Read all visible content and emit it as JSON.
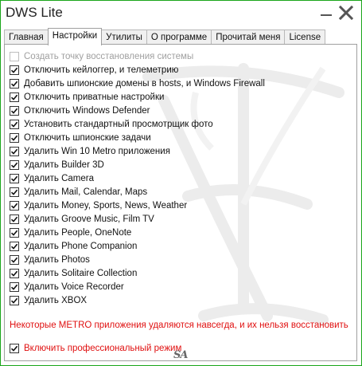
{
  "window": {
    "title": "DWS Lite"
  },
  "tabs": [
    {
      "label": "Главная",
      "active": false
    },
    {
      "label": "Настройки",
      "active": true
    },
    {
      "label": "Утилиты",
      "active": false
    },
    {
      "label": "О программе",
      "active": false
    },
    {
      "label": "Прочитай меня",
      "active": false
    },
    {
      "label": "License",
      "active": false
    }
  ],
  "options": [
    {
      "label": "Создать точку восстановления системы",
      "checked": false,
      "disabled": true
    },
    {
      "label": "Отключить кейлоггер, и телеметрию",
      "checked": true,
      "disabled": false
    },
    {
      "label": "Добавить шпионские домены в hosts, и Windows Firewall",
      "checked": true,
      "disabled": false
    },
    {
      "label": "Отключить приватные настройки",
      "checked": true,
      "disabled": false
    },
    {
      "label": "Отключить Windows Defender",
      "checked": true,
      "disabled": false
    },
    {
      "label": "Установить стандартный просмотрщик фото",
      "checked": true,
      "disabled": false
    },
    {
      "label": "Отключить шпионские задачи",
      "checked": true,
      "disabled": false
    },
    {
      "label": "Удалить Win 10 Metro приложения",
      "checked": true,
      "disabled": false
    },
    {
      "label": "Удалить Builder 3D",
      "checked": true,
      "disabled": false
    },
    {
      "label": "Удалить Camera",
      "checked": true,
      "disabled": false
    },
    {
      "label": "Удалить Mail, Calendar, Maps",
      "checked": true,
      "disabled": false
    },
    {
      "label": "Удалить Money, Sports, News, Weather",
      "checked": true,
      "disabled": false
    },
    {
      "label": "Удалить Groove Music, Film TV",
      "checked": true,
      "disabled": false
    },
    {
      "label": "Удалить People, OneNote",
      "checked": true,
      "disabled": false
    },
    {
      "label": "Удалить Phone Companion",
      "checked": true,
      "disabled": false
    },
    {
      "label": "Удалить Photos",
      "checked": true,
      "disabled": false
    },
    {
      "label": "Удалить Solitaire Collection",
      "checked": true,
      "disabled": false
    },
    {
      "label": "Удалить Voice Recorder",
      "checked": true,
      "disabled": false
    },
    {
      "label": "Удалить XBOX",
      "checked": true,
      "disabled": false
    }
  ],
  "warning": "Некоторые METRO приложения удаляются навсегда, и их нельзя восстановить",
  "pro_mode": {
    "label": "Включить профессиональный режим",
    "checked": true
  },
  "signature": "SA",
  "colors": {
    "border": "#1aa61a",
    "warning": "#e01010"
  },
  "icons": {
    "minimize": "minimize-icon",
    "close": "close-icon",
    "check": "checkmark-icon"
  }
}
